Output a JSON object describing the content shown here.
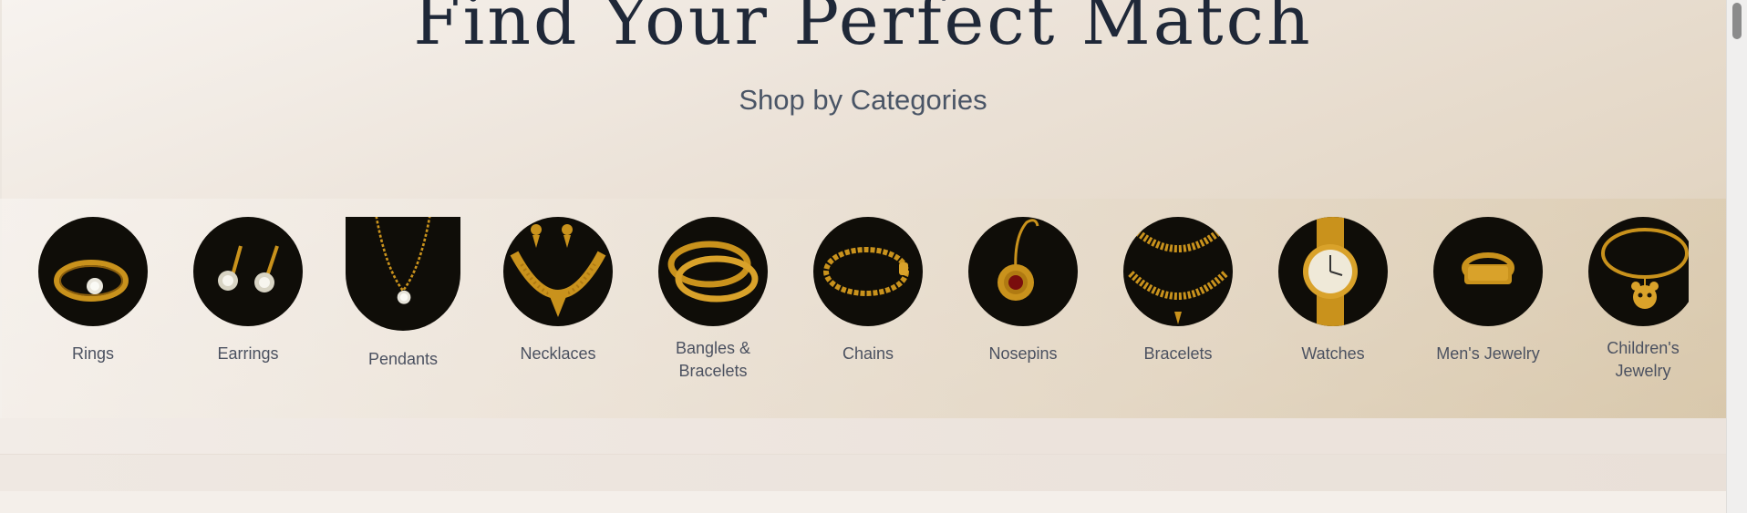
{
  "hero": {
    "title": "Find Your Perfect Match",
    "subtitle": "Shop by Categories"
  },
  "categories": [
    {
      "label": "Rings",
      "icon": "ring-icon"
    },
    {
      "label": "Earrings",
      "icon": "stud-earrings-icon"
    },
    {
      "label": "Pendants",
      "icon": "pendant-icon"
    },
    {
      "label": "Necklaces",
      "icon": "necklace-icon"
    },
    {
      "label": "Bangles & Bracelets",
      "icon": "bangles-icon"
    },
    {
      "label": "Chains",
      "icon": "chain-bracelet-icon"
    },
    {
      "label": "Nosepins",
      "icon": "nosepin-icon"
    },
    {
      "label": "Bracelets",
      "icon": "layered-necklace-icon"
    },
    {
      "label": "Watches",
      "icon": "watch-icon"
    },
    {
      "label": "Men's Jewelry",
      "icon": "signet-ring-icon"
    },
    {
      "label": "Children's Jewelry",
      "icon": "charm-bracelet-icon"
    }
  ],
  "colors": {
    "heading": "#1f2838",
    "gold": "#c9921c",
    "thumb_bg": "#0f0d08"
  }
}
